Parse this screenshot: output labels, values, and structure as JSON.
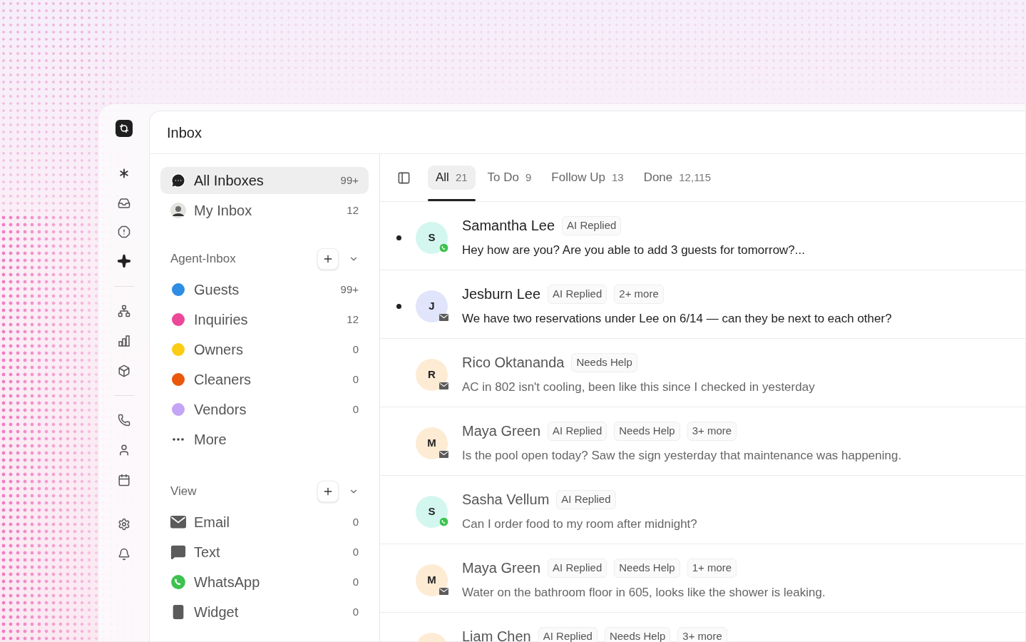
{
  "header": {
    "title": "Inbox"
  },
  "sidebar": {
    "primary": [
      {
        "kind": "chat",
        "label": "All Inboxes",
        "count": "99+",
        "selected": true
      },
      {
        "kind": "avatar",
        "label": "My Inbox",
        "count": "12",
        "selected": false
      }
    ],
    "sections": [
      {
        "title": "Agent-Inbox",
        "items": [
          {
            "kind": "dot",
            "label": "Guests",
            "count": "99+",
            "color": "#2f8de4"
          },
          {
            "kind": "dot",
            "label": "Inquiries",
            "count": "12",
            "color": "#ec4899"
          },
          {
            "kind": "dot",
            "label": "Owners",
            "count": "0",
            "color": "#facc15"
          },
          {
            "kind": "dot",
            "label": "Cleaners",
            "count": "0",
            "color": "#ea580c"
          },
          {
            "kind": "dot",
            "label": "Vendors",
            "count": "0",
            "color": "#c4a5f5"
          },
          {
            "kind": "more",
            "label": "More"
          }
        ]
      },
      {
        "title": "View",
        "items": [
          {
            "kind": "email",
            "label": "Email",
            "count": "0"
          },
          {
            "kind": "text",
            "label": "Text",
            "count": "0"
          },
          {
            "kind": "whatsapp",
            "label": "WhatsApp",
            "count": "0"
          },
          {
            "kind": "widget",
            "label": "Widget",
            "count": "0"
          }
        ]
      }
    ]
  },
  "tabs": [
    {
      "label": "All",
      "count": "21",
      "selected": true
    },
    {
      "label": "To Do",
      "count": "9",
      "selected": false
    },
    {
      "label": "Follow Up",
      "count": "13",
      "selected": false
    },
    {
      "label": "Done",
      "count": "12,115",
      "selected": false
    }
  ],
  "conversations": [
    {
      "initial": "S",
      "color": "#d3f7ee",
      "kind": "whatsapp",
      "unread": true,
      "name": "Samantha Lee",
      "tags": [
        "AI Replied"
      ],
      "preview": "Hey how are you? Are you able to add 3 guests for tomorrow?..."
    },
    {
      "initial": "J",
      "color": "#e1e5fb",
      "kind": "email",
      "unread": true,
      "name": "Jesburn Lee",
      "tags": [
        "AI Replied",
        "2+ more"
      ],
      "preview": "We have two reservations under Lee on 6/14 — can they be next to each other?"
    },
    {
      "initial": "R",
      "color": "#fdebd4",
      "kind": "email",
      "unread": false,
      "name": "Rico Oktananda",
      "tags": [
        "Needs Help"
      ],
      "preview": "AC in 802 isn't cooling, been like this since I checked in yesterday"
    },
    {
      "initial": "M",
      "color": "#fdebd4",
      "kind": "email",
      "unread": false,
      "name": "Maya Green",
      "tags": [
        "AI Replied",
        "Needs Help",
        "3+ more"
      ],
      "preview": "Is the pool open today? Saw the sign yesterday that maintenance was happening."
    },
    {
      "initial": "S",
      "color": "#d3f7ee",
      "kind": "whatsapp",
      "unread": false,
      "name": "Sasha Vellum",
      "tags": [
        "AI Replied"
      ],
      "preview": "Can I order food to my room after midnight?"
    },
    {
      "initial": "M",
      "color": "#fdebd4",
      "kind": "email",
      "unread": false,
      "name": "Maya Green",
      "tags": [
        "AI Replied",
        "Needs Help",
        "1+ more"
      ],
      "preview": "Water on the bathroom floor in 605, looks like the shower is leaking."
    },
    {
      "color": "#fdebd4",
      "unread": false,
      "name": "Liam Chen",
      "tags": [
        "AI Replied",
        "Needs Help",
        "3+ more"
      ]
    }
  ]
}
